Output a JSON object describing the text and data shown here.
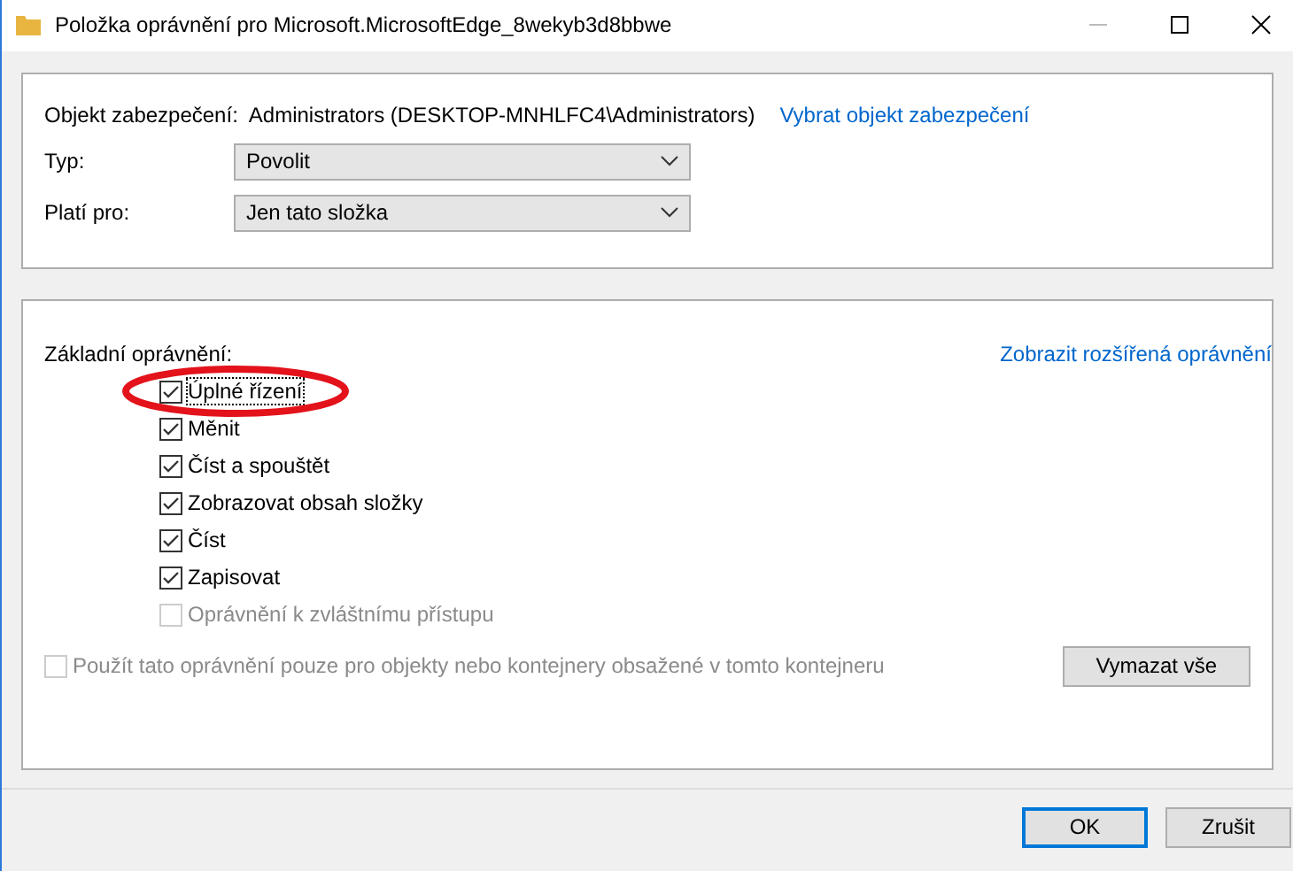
{
  "window": {
    "title": "Položka oprávnění pro Microsoft.MicrosoftEdge_8wekyb3d8bbwe"
  },
  "principal": {
    "label": "Objekt zabezpečení:",
    "value": "Administrators (DESKTOP-MNHLFC4\\Administrators)",
    "link": "Vybrat objekt zabezpečení"
  },
  "fields": [
    {
      "label": "Typ:",
      "value": "Povolit"
    },
    {
      "label": "Platí pro:",
      "value": "Jen tato složka"
    }
  ],
  "permissions": {
    "title": "Základní oprávnění:",
    "link": "Zobrazit rozšířená oprávnění",
    "items": [
      {
        "label": "Úplné řízení",
        "checked": true,
        "disabled": false,
        "focused": true
      },
      {
        "label": "Měnit",
        "checked": true,
        "disabled": false,
        "focused": false
      },
      {
        "label": "Číst a spouštět",
        "checked": true,
        "disabled": false,
        "focused": false
      },
      {
        "label": "Zobrazovat obsah složky",
        "checked": true,
        "disabled": false,
        "focused": false
      },
      {
        "label": "Číst",
        "checked": true,
        "disabled": false,
        "focused": false
      },
      {
        "label": "Zapisovat",
        "checked": true,
        "disabled": false,
        "focused": false
      },
      {
        "label": "Oprávnění k zvláštnímu přístupu",
        "checked": false,
        "disabled": true,
        "focused": false
      }
    ],
    "apply_only": {
      "label": "Použít tato oprávnění pouze pro objekty nebo kontejnery obsažené v tomto kontejneru",
      "checked": false,
      "disabled": true
    },
    "clear_button": "Vymazat vše"
  },
  "buttons": [
    {
      "label": "OK",
      "default": true
    },
    {
      "label": "Zrušit",
      "default": false
    }
  ]
}
